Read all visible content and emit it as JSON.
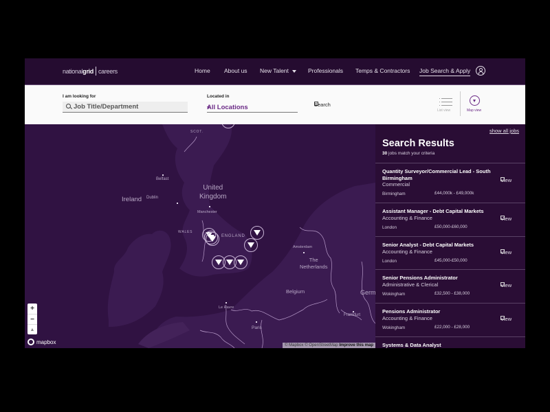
{
  "header": {
    "logo": {
      "part1": "national",
      "part2": "grid",
      "part3": "careers"
    },
    "nav": [
      {
        "label": "Home"
      },
      {
        "label": "About us"
      },
      {
        "label": "New Talent",
        "has_dropdown": true
      },
      {
        "label": "Professionals"
      },
      {
        "label": "Temps & Contractors"
      },
      {
        "label": "Job Search & Apply",
        "active": true
      }
    ],
    "account_icon": "user-circle-icon"
  },
  "search": {
    "looking_for_label": "I am looking for",
    "job_placeholder": "Job Title/Department",
    "located_in_label": "Located in",
    "location_value": "All Locations",
    "search_button": "Search",
    "list_view_label": "List view",
    "map_view_label": "Map view",
    "active_view": "map"
  },
  "map": {
    "labels": {
      "scot": "SCOT.",
      "ireland": "Ireland",
      "dublin": "Dublin",
      "belfast": "Belfast",
      "uk_line1": "United",
      "uk_line2": "Kingdom",
      "manchester": "Manchester",
      "wales": "WALES",
      "england": "ENGLAND",
      "amsterdam": "Amsterdam",
      "netherlands_line1": "The",
      "netherlands_line2": "Netherlands",
      "belgium": "Belgium",
      "germany": "Germ",
      "le_havre": "Le Havre",
      "paris": "Paris",
      "frankfurt": "Frankfurt"
    },
    "zoom_in": "+",
    "zoom_out": "−",
    "compass": "▲",
    "mapbox_logo": "mapbox",
    "attribution": {
      "mapbox": "© Mapbox",
      "osm": "© OpenStreetMap",
      "improve": "Improve this map"
    },
    "colors": {
      "land": "#3a1a4f",
      "water": "#2e1140",
      "border": "#b79ac9"
    }
  },
  "results": {
    "show_all": "show all jobs",
    "title": "Search Results",
    "count": "30",
    "count_suffix": "jobs match your criteria",
    "view_label": "View",
    "jobs": [
      {
        "title": "Quantity Surveyor/Commercial Lead - South Birmingham",
        "category": "Commercial",
        "location": "Birmingham",
        "salary": "£44,000k - £49,000k"
      },
      {
        "title": "Assistant Manager - Debt Capital Markets",
        "category": "Accounting & Finance",
        "location": "London",
        "salary": "£50,000-£60,000"
      },
      {
        "title": "Senior Analyst - Debt Capital Markets",
        "category": "Accounting & Finance",
        "location": "London",
        "salary": "£45,000-£50,000"
      },
      {
        "title": "Senior Pensions Administrator",
        "category": "Administrative & Clerical",
        "location": "Wokingham",
        "salary": "£32,500 - £38,000"
      },
      {
        "title": "Pensions Administrator",
        "category": "Accounting & Finance",
        "location": "Wokingham",
        "salary": "£22,000 - £28,000"
      },
      {
        "title": "Systems & Data Analyst",
        "category": "",
        "location": "",
        "salary": ""
      }
    ]
  }
}
